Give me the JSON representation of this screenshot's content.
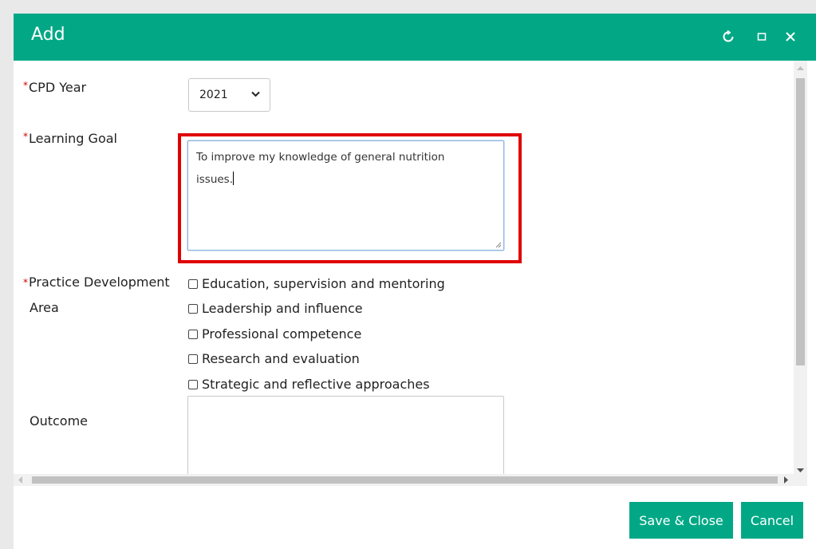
{
  "dialog": {
    "title": "Add",
    "controls": {
      "refresh_icon": "refresh-icon",
      "maximize_icon": "maximize-icon",
      "close_icon": "close-icon"
    }
  },
  "form": {
    "cpd_year": {
      "label": "CPD Year",
      "value": "2021"
    },
    "learning_goal": {
      "label": "Learning Goal",
      "line1": "To improve my knowledge of general nutrition",
      "line2": "issues."
    },
    "practice_area": {
      "label_line1": "Practice Development",
      "label_line2": "Area",
      "options": [
        "Education, supervision and mentoring",
        "Leadership and influence",
        "Professional competence",
        "Research and evaluation",
        "Strategic and reflective approaches"
      ]
    },
    "outcome": {
      "label": "Outcome",
      "value": ""
    }
  },
  "footer": {
    "save_label": "Save & Close",
    "cancel_label": "Cancel"
  },
  "colors": {
    "accent": "#02a886",
    "required": "#d40000",
    "highlight": "#e00000"
  }
}
